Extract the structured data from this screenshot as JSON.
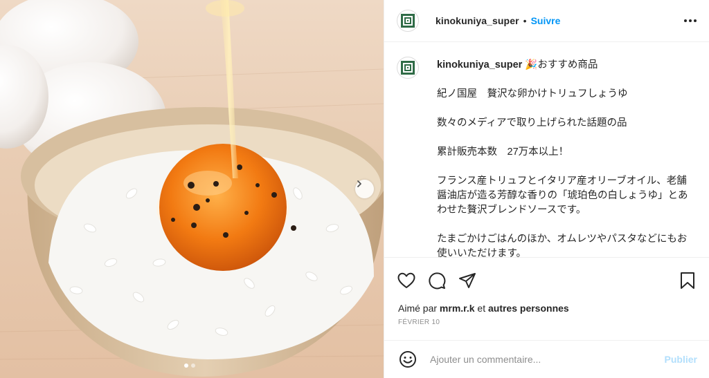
{
  "post": {
    "image_alt": "Egg on rice with truffle soy sauce being poured",
    "carousel": {
      "current": 1,
      "total": 2
    }
  },
  "header": {
    "username": "kinokuniya_super",
    "separator": "•",
    "follow_label": "Suivre"
  },
  "caption": {
    "username": "kinokuniya_super",
    "first_line": "🎉おすすめ商品",
    "paragraphs": [
      "紀ノ国屋　贅沢な卵かけトリュフしょうゆ",
      "数々のメディアで取り上げられた話題の品",
      "累計販売本数　27万本以上！",
      "フランス産トリュフとイタリア産オリーブオイル、老舗醤油店が造る芳醇な香りの「琥珀色の白しょうゆ」とあわせた贅沢ブレンドソースです。",
      "たまごかけごはんのほか、オムレツやパスタなどにもお使いいただけます。"
    ]
  },
  "actions": {
    "like_icon": "heart-icon",
    "comment_icon": "comment-icon",
    "share_icon": "paper-plane-icon",
    "save_icon": "bookmark-icon"
  },
  "likes": {
    "prefix": "Aimé par ",
    "user": "mrm.r.k",
    "middle": " et ",
    "others": "autres personnes"
  },
  "date": "FÉVRIER 10",
  "comment": {
    "placeholder": "Ajouter un commentaire...",
    "post_label": "Publier"
  },
  "colors": {
    "accent": "#0095f6",
    "post_disabled": "#b2dffc",
    "text": "#262626",
    "muted": "#8e8e8e"
  }
}
